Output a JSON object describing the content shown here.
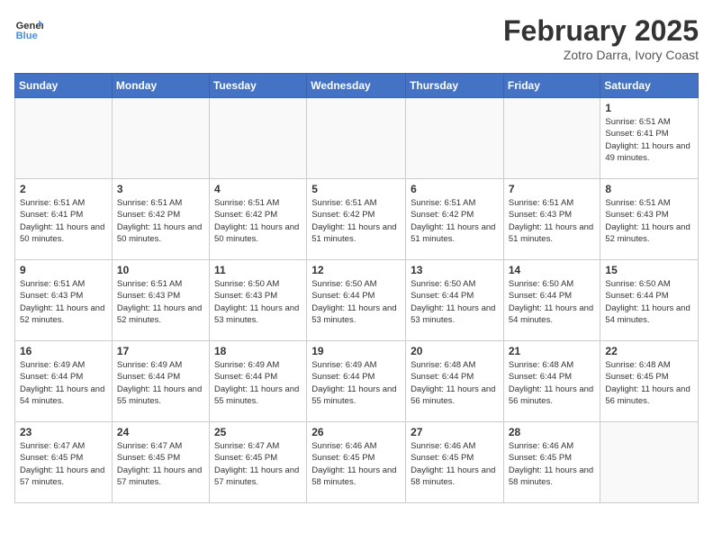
{
  "header": {
    "logo_line1": "General",
    "logo_line2": "Blue",
    "month_year": "February 2025",
    "location": "Zotro Darra, Ivory Coast"
  },
  "days_of_week": [
    "Sunday",
    "Monday",
    "Tuesday",
    "Wednesday",
    "Thursday",
    "Friday",
    "Saturday"
  ],
  "weeks": [
    [
      {
        "day": "",
        "info": ""
      },
      {
        "day": "",
        "info": ""
      },
      {
        "day": "",
        "info": ""
      },
      {
        "day": "",
        "info": ""
      },
      {
        "day": "",
        "info": ""
      },
      {
        "day": "",
        "info": ""
      },
      {
        "day": "1",
        "info": "Sunrise: 6:51 AM\nSunset: 6:41 PM\nDaylight: 11 hours and 49 minutes."
      }
    ],
    [
      {
        "day": "2",
        "info": "Sunrise: 6:51 AM\nSunset: 6:41 PM\nDaylight: 11 hours and 50 minutes."
      },
      {
        "day": "3",
        "info": "Sunrise: 6:51 AM\nSunset: 6:42 PM\nDaylight: 11 hours and 50 minutes."
      },
      {
        "day": "4",
        "info": "Sunrise: 6:51 AM\nSunset: 6:42 PM\nDaylight: 11 hours and 50 minutes."
      },
      {
        "day": "5",
        "info": "Sunrise: 6:51 AM\nSunset: 6:42 PM\nDaylight: 11 hours and 51 minutes."
      },
      {
        "day": "6",
        "info": "Sunrise: 6:51 AM\nSunset: 6:42 PM\nDaylight: 11 hours and 51 minutes."
      },
      {
        "day": "7",
        "info": "Sunrise: 6:51 AM\nSunset: 6:43 PM\nDaylight: 11 hours and 51 minutes."
      },
      {
        "day": "8",
        "info": "Sunrise: 6:51 AM\nSunset: 6:43 PM\nDaylight: 11 hours and 52 minutes."
      }
    ],
    [
      {
        "day": "9",
        "info": "Sunrise: 6:51 AM\nSunset: 6:43 PM\nDaylight: 11 hours and 52 minutes."
      },
      {
        "day": "10",
        "info": "Sunrise: 6:51 AM\nSunset: 6:43 PM\nDaylight: 11 hours and 52 minutes."
      },
      {
        "day": "11",
        "info": "Sunrise: 6:50 AM\nSunset: 6:43 PM\nDaylight: 11 hours and 53 minutes."
      },
      {
        "day": "12",
        "info": "Sunrise: 6:50 AM\nSunset: 6:44 PM\nDaylight: 11 hours and 53 minutes."
      },
      {
        "day": "13",
        "info": "Sunrise: 6:50 AM\nSunset: 6:44 PM\nDaylight: 11 hours and 53 minutes."
      },
      {
        "day": "14",
        "info": "Sunrise: 6:50 AM\nSunset: 6:44 PM\nDaylight: 11 hours and 54 minutes."
      },
      {
        "day": "15",
        "info": "Sunrise: 6:50 AM\nSunset: 6:44 PM\nDaylight: 11 hours and 54 minutes."
      }
    ],
    [
      {
        "day": "16",
        "info": "Sunrise: 6:49 AM\nSunset: 6:44 PM\nDaylight: 11 hours and 54 minutes."
      },
      {
        "day": "17",
        "info": "Sunrise: 6:49 AM\nSunset: 6:44 PM\nDaylight: 11 hours and 55 minutes."
      },
      {
        "day": "18",
        "info": "Sunrise: 6:49 AM\nSunset: 6:44 PM\nDaylight: 11 hours and 55 minutes."
      },
      {
        "day": "19",
        "info": "Sunrise: 6:49 AM\nSunset: 6:44 PM\nDaylight: 11 hours and 55 minutes."
      },
      {
        "day": "20",
        "info": "Sunrise: 6:48 AM\nSunset: 6:44 PM\nDaylight: 11 hours and 56 minutes."
      },
      {
        "day": "21",
        "info": "Sunrise: 6:48 AM\nSunset: 6:44 PM\nDaylight: 11 hours and 56 minutes."
      },
      {
        "day": "22",
        "info": "Sunrise: 6:48 AM\nSunset: 6:45 PM\nDaylight: 11 hours and 56 minutes."
      }
    ],
    [
      {
        "day": "23",
        "info": "Sunrise: 6:47 AM\nSunset: 6:45 PM\nDaylight: 11 hours and 57 minutes."
      },
      {
        "day": "24",
        "info": "Sunrise: 6:47 AM\nSunset: 6:45 PM\nDaylight: 11 hours and 57 minutes."
      },
      {
        "day": "25",
        "info": "Sunrise: 6:47 AM\nSunset: 6:45 PM\nDaylight: 11 hours and 57 minutes."
      },
      {
        "day": "26",
        "info": "Sunrise: 6:46 AM\nSunset: 6:45 PM\nDaylight: 11 hours and 58 minutes."
      },
      {
        "day": "27",
        "info": "Sunrise: 6:46 AM\nSunset: 6:45 PM\nDaylight: 11 hours and 58 minutes."
      },
      {
        "day": "28",
        "info": "Sunrise: 6:46 AM\nSunset: 6:45 PM\nDaylight: 11 hours and 58 minutes."
      },
      {
        "day": "",
        "info": ""
      }
    ]
  ]
}
